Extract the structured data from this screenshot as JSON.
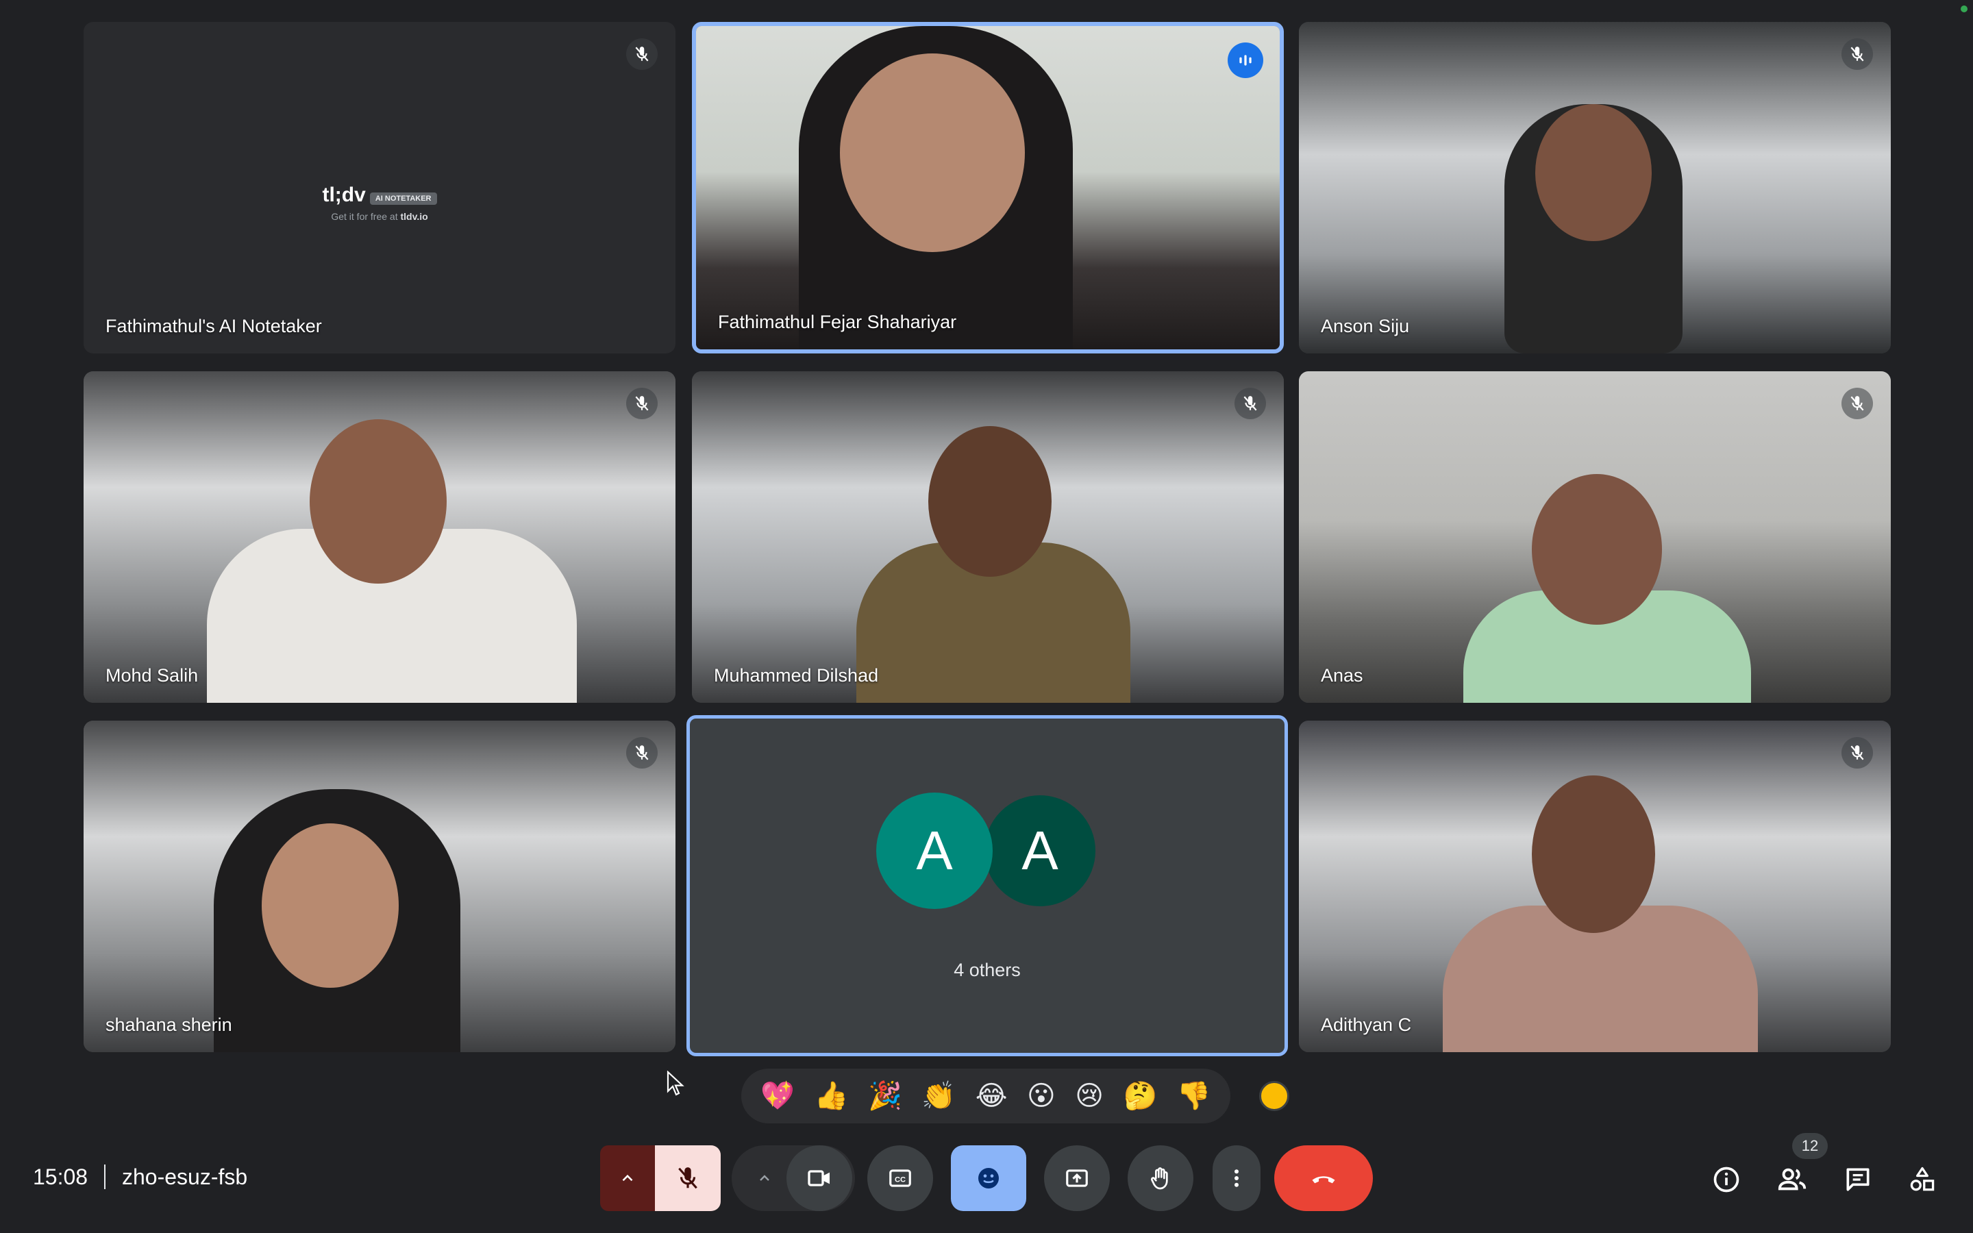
{
  "participants": [
    {
      "name": "Fathimathul's AI Notetaker",
      "muted": true
    },
    {
      "name": "Fathimathul Fejar Shahariyar",
      "speaking": true
    },
    {
      "name": "Anson Siju",
      "muted": true
    },
    {
      "name": "Mohd Salih",
      "muted": true
    },
    {
      "name": "Muhammed Dilshad",
      "muted": true
    },
    {
      "name": "Anas",
      "muted": true
    },
    {
      "name": "shahana sherin",
      "muted": true
    },
    {
      "name": "Adithyan C",
      "muted": true
    }
  ],
  "notetaker": {
    "title": "tl;dv",
    "tag": "AI NOTETAKER",
    "subtitle": "Get it for free at",
    "link": "tldv.io"
  },
  "others": {
    "avatars": [
      {
        "initial": "A",
        "color": "#00897b"
      },
      {
        "initial": "A",
        "color": "#004d40"
      }
    ],
    "label": "4 others"
  },
  "reactions": [
    "💖",
    "👍",
    "🎉",
    "👏",
    "😂",
    "😮",
    "😢",
    "🤔",
    "👎"
  ],
  "bottom_bar": {
    "time": "15:08",
    "meeting_code": "zho-esuz-fsb",
    "people_count": "12"
  },
  "colors": {
    "background": "#202124",
    "tile": "#3c4043",
    "speaking_border": "#8ab4f8",
    "end_call": "#ea4335",
    "mic_muted_bg": "#f9dedc",
    "reactions_active": "#8ab4f8"
  }
}
